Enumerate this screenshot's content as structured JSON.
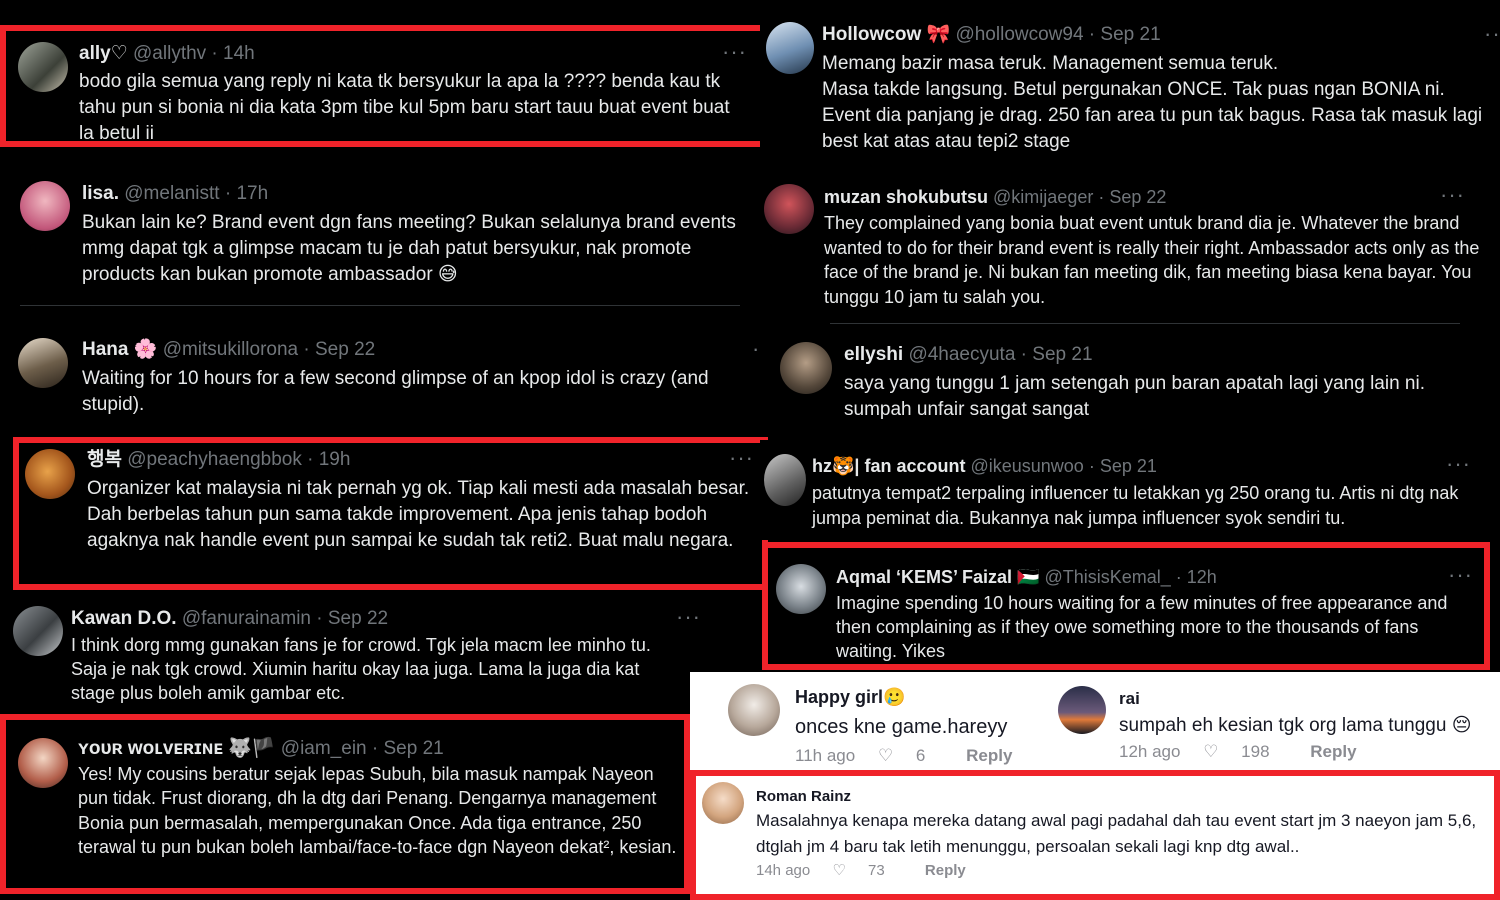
{
  "tweets_left": [
    {
      "name": "ally♡",
      "handle": "@allythv · 14h",
      "text": "bodo gila semua yang reply ni kata tk bersyukur la apa la ???? benda kau tk tahu pun si bonia ni dia kata 3pm tibe kul 5pm baru start tauu buat event buat la betul ii",
      "more": "···"
    },
    {
      "name": "lisa.",
      "handle": "@melanistt · 17h",
      "text": "Bukan lain ke? Brand event dgn fans meeting? Bukan selalunya brand events mmg dapat tgk a glimpse macam tu je dah patut bersyukur, nak promote products kan bukan promote ambassador 😅"
    },
    {
      "name": "Hana 🌸",
      "handle": "@mitsukillorona · Sep 22",
      "text": "Waiting for 10 hours for a few second glimpse of an kpop idol is crazy (and stupid).",
      "more": "··"
    },
    {
      "name": "행복",
      "handle": "@peachyhaengbbok · 19h",
      "text": "Organizer kat malaysia ni tak pernah yg ok. Tiap kali mesti ada masalah besar. Dah berbelas tahun pun sama takde improvement. Apa jenis tahap bodoh agaknya nak handle event pun sampai ke sudah tak reti2. Buat malu negara.",
      "more": "···"
    },
    {
      "name": "Kawan D.O.",
      "handle": "@fanurainamin · Sep 22",
      "text": "I think dorg mmg gunakan fans je for crowd. Tgk jela macm lee minho tu. Saja je nak tgk crowd. Xiumin haritu okay laa juga. Lama la juga dia kat stage plus boleh amik gambar etc.",
      "more": "···"
    },
    {
      "name": "ʏᴏᴜʀ ᴡᴏʟᴠᴇʀɪɴᴇ 🐺🏴",
      "handle": "@iam_ein · Sep 21",
      "text": "Yes! My cousins beratur sejak lepas Subuh, bila masuk nampak Nayeon pun tidak. Frust diorang, dh la dtg dari Penang. Dengarnya management Bonia pun bermasalah, mempergunakan Once. Ada tiga entrance, 250 terawal tu  pun bukan boleh lambai/face-to-face dgn Nayeon dekat², kesian."
    }
  ],
  "tweets_right": [
    {
      "name": "Hollowcow 🎀",
      "handle": "@hollowcow94 · Sep 21",
      "text": "Memang bazir masa teruk. Management semua teruk.\nMasa takde langsung. Betul pergunakan ONCE. Tak puas ngan BONIA ni.\nEvent dia panjang je drag. 250 fan area tu pun tak bagus. Rasa tak masuk lagi best kat atas atau tepi2 stage",
      "more": "··"
    },
    {
      "name": "muzan shokubutsu",
      "handle": "@kimijaeger · Sep 22",
      "text": "They complained yang bonia buat event untuk brand dia je. Whatever the brand wanted to do for their brand event is really their right. Ambassador acts only as the face of the brand je. Ni bukan fan meeting dik, fan meeting biasa kena bayar. You tunggu 10 jam tu salah you.",
      "more": "···"
    },
    {
      "name": "ellyshi",
      "handle": "@4haecyuta · Sep 21",
      "text": "saya yang tunggu 1 jam setengah pun baran apatah lagi yang lain ni.\nsumpah unfair sangat sangat"
    },
    {
      "name": "hz🐯| fan account",
      "handle": "@ikeusunwoo · Sep 21",
      "text": "patutnya tempat2 terpaling influencer tu letakkan yg 250 orang tu. Artis ni dtg nak jumpa peminat dia. Bukannya nak jumpa influencer syok sendiri tu.",
      "more": "···"
    },
    {
      "name": "Aqmal ‘KEMS’ Faizal 🇵🇸",
      "handle": "@ThisisKemal_ · 12h",
      "text": "Imagine spending 10 hours waiting for a few minutes of free appearance and then complaining as if they owe something more to the thousands of fans waiting. Yikes",
      "more": "···"
    }
  ],
  "tiktok": [
    {
      "name": "Happy girl🥲",
      "text": "onces kne game.hareyy",
      "time": "11h ago",
      "likes": "6",
      "reply": "Reply"
    },
    {
      "name": "rai",
      "text": "sumpah eh kesian tgk org lama tunggu 😔",
      "time": "12h ago",
      "likes": "198",
      "reply": "Reply"
    },
    {
      "name": "Roman Rainz",
      "text": "Masalahnya kenapa mereka datang awal pagi padahal dah tau event start jm 3 naeyon jam 5,6, dtglah jm 4 baru tak letih menunggu, persoalan sekali lagi knp dtg awal..",
      "time": "14h ago",
      "likes": "73",
      "reply": "Reply"
    }
  ],
  "colors": {
    "highlight": "#f0232a",
    "x_bg": "#000000",
    "x_text": "#e7e9ea",
    "x_muted": "#71767b",
    "tt_bg": "#ffffff"
  }
}
